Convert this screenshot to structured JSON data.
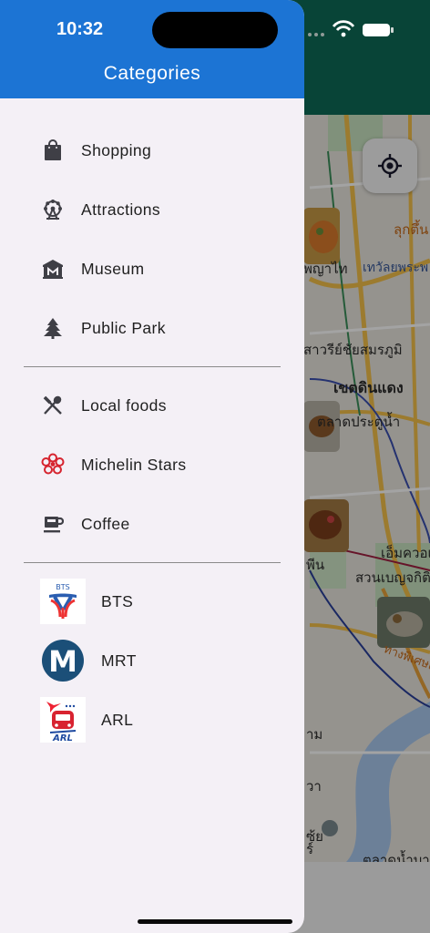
{
  "status_bar": {
    "time": "10:32"
  },
  "drawer": {
    "title": "Categories",
    "sections": [
      {
        "items": [
          {
            "label": "Shopping",
            "icon": "shopping-bag-icon"
          },
          {
            "label": "Attractions",
            "icon": "ferris-wheel-icon"
          },
          {
            "label": "Museum",
            "icon": "museum-icon"
          },
          {
            "label": "Public Park",
            "icon": "tree-icon"
          }
        ]
      },
      {
        "items": [
          {
            "label": "Local foods",
            "icon": "fork-spoon-icon"
          },
          {
            "label": "Michelin Stars",
            "icon": "michelin-star-icon"
          },
          {
            "label": "Coffee",
            "icon": "coffee-cup-icon"
          }
        ]
      },
      {
        "items": [
          {
            "label": "BTS",
            "logo_text": "BTS",
            "icon": "bts-logo"
          },
          {
            "label": "MRT",
            "logo_text": "M",
            "icon": "mrt-logo"
          },
          {
            "label": "ARL",
            "logo_text": "ARL",
            "icon": "arl-logo"
          }
        ]
      }
    ]
  },
  "map": {
    "labels": [
      "ลุกตึ้น",
      "พญาไท",
      "เทวัลยพระพ",
      "สาวรีย์ชัยสมรภูมิ",
      "เขตดินแดง",
      "ตลาดประตูน้ำ",
      "เอ็มควอเทีย",
      "พีน",
      "สวนเบญจกิติ",
      "าม",
      "วา",
      "ตลาดน้ำบาง",
      "ทางพิเศษเฉ",
      "ซ้ย",
      "ร์"
    ]
  },
  "colors": {
    "header": "#1c74d4",
    "drawer_bg": "#f4f0f6",
    "map_header": "#0d6b57",
    "michelin_red": "#d6242f"
  }
}
